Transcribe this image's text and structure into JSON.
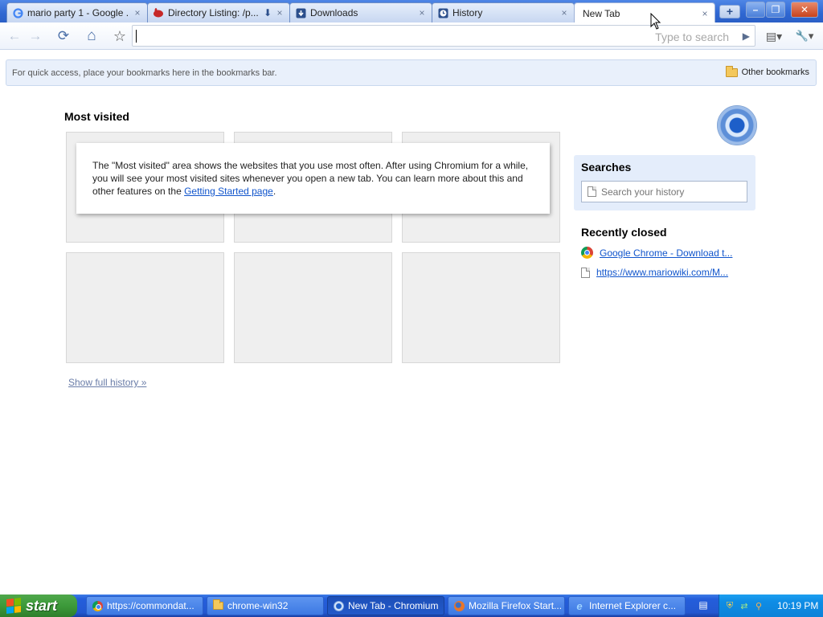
{
  "tabs": [
    {
      "title": "mario party 1 - Google ...",
      "icon": "google-icon",
      "close": "×"
    },
    {
      "title": "Directory Listing: /p...",
      "icon": "rabbit-icon",
      "close": "×",
      "download": "⬇"
    },
    {
      "title": "Downloads",
      "icon": "download-icon",
      "close": "×"
    },
    {
      "title": "History",
      "icon": "clock-icon",
      "close": "×"
    },
    {
      "title": "New Tab",
      "icon": "",
      "close": "×"
    }
  ],
  "new_tab_button": "+",
  "window_controls": {
    "minimize": "–",
    "maximize": "❐",
    "close": "✕"
  },
  "toolbar": {
    "back": "←",
    "forward": "→",
    "reload": "⟳",
    "home": "⌂",
    "star": "☆",
    "omnibox_value": "",
    "search_hint": "Type to search",
    "go": "▶",
    "page_menu": "▤▾",
    "wrench_menu": "🔧▾"
  },
  "bookmarks_bar": {
    "hint": "For quick access, place your bookmarks here in the bookmarks bar.",
    "other_bookmarks": "Other bookmarks"
  },
  "most_visited": {
    "title": "Most visited",
    "info_text_before": "The \"Most visited\" area shows the websites that you use most often. After using Chromium for a while, you will see your most visited sites whenever you open a new tab. You can learn more about this and other features on the ",
    "info_link": "Getting Started page",
    "info_text_after": ".",
    "show_full_history": "Show full history »"
  },
  "searches": {
    "title": "Searches",
    "placeholder": "Search your history"
  },
  "recently_closed": {
    "title": "Recently closed",
    "items": [
      {
        "label": "Google Chrome - Download t...",
        "icon": "chrome-icon"
      },
      {
        "label": "https://www.mariowiki.com/M...",
        "icon": "page-icon"
      }
    ]
  },
  "taskbar": {
    "start": "start",
    "items": [
      {
        "label": "https://commondat...",
        "icon": "chrome-icon"
      },
      {
        "label": "chrome-win32",
        "icon": "folder-icon"
      },
      {
        "label": "New Tab - Chromium",
        "icon": "chromium-icon"
      },
      {
        "label": "Mozilla Firefox Start...",
        "icon": "firefox-icon"
      },
      {
        "label": "Internet Explorer c...",
        "icon": "ie-icon"
      }
    ],
    "clock": "10:19 PM"
  }
}
